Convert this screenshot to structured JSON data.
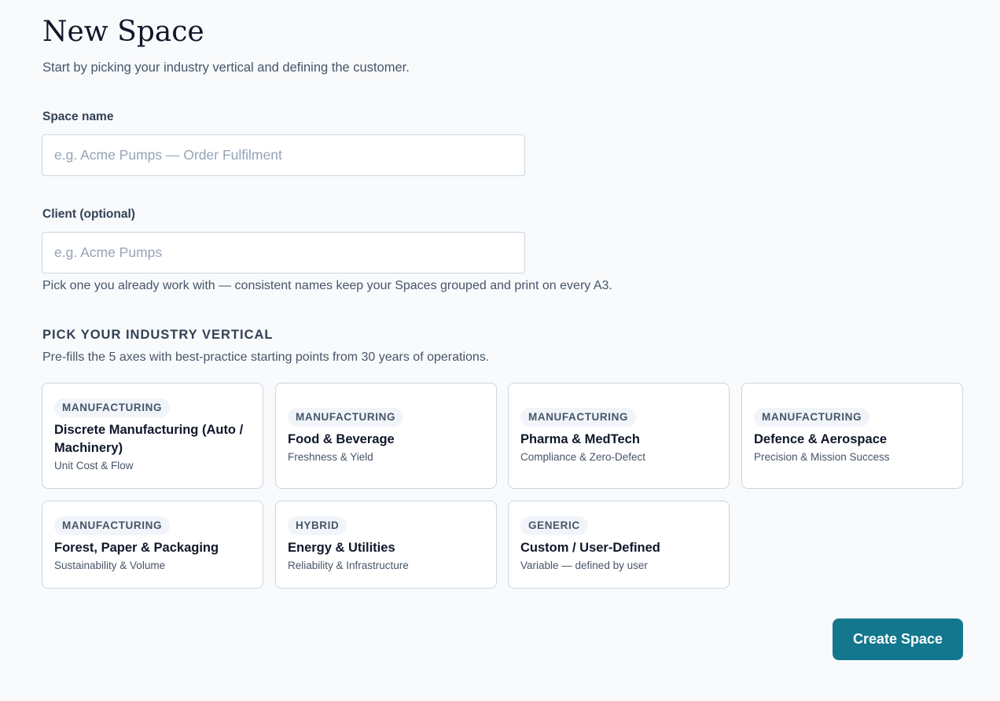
{
  "header": {
    "title": "New Space",
    "subtitle": "Start by picking your industry vertical and defining the customer."
  },
  "form": {
    "space_name": {
      "label": "Space name",
      "value": "",
      "placeholder": "e.g. Acme Pumps — Order Fulfilment"
    },
    "client": {
      "label": "Client (optional)",
      "value": "",
      "placeholder": "e.g. Acme Pumps",
      "help": "Pick one you already work with — consistent names keep your Spaces grouped and print on every A3."
    }
  },
  "verticals": {
    "heading": "PICK YOUR INDUSTRY VERTICAL",
    "subtitle": "Pre-fills the 5 axes with best-practice starting points from 30 years of operations.",
    "items": [
      {
        "badge": "MANUFACTURING",
        "title": "Discrete Manufacturing (Auto / Machinery)",
        "subtitle": "Unit Cost & Flow"
      },
      {
        "badge": "MANUFACTURING",
        "title": "Food & Beverage",
        "subtitle": "Freshness & Yield"
      },
      {
        "badge": "MANUFACTURING",
        "title": "Pharma & MedTech",
        "subtitle": "Compliance & Zero-Defect"
      },
      {
        "badge": "MANUFACTURING",
        "title": "Defence & Aerospace",
        "subtitle": "Precision & Mission Success"
      },
      {
        "badge": "MANUFACTURING",
        "title": "Forest, Paper & Packaging",
        "subtitle": "Sustainability & Volume"
      },
      {
        "badge": "HYBRID",
        "title": "Energy & Utilities",
        "subtitle": "Reliability & Infrastructure"
      },
      {
        "badge": "GENERIC",
        "title": "Custom / User-Defined",
        "subtitle": "Variable — defined by user"
      }
    ]
  },
  "actions": {
    "create_label": "Create Space"
  },
  "colors": {
    "accent": "#13778e",
    "background": "#f8fafc",
    "border": "#cbd5e1"
  }
}
